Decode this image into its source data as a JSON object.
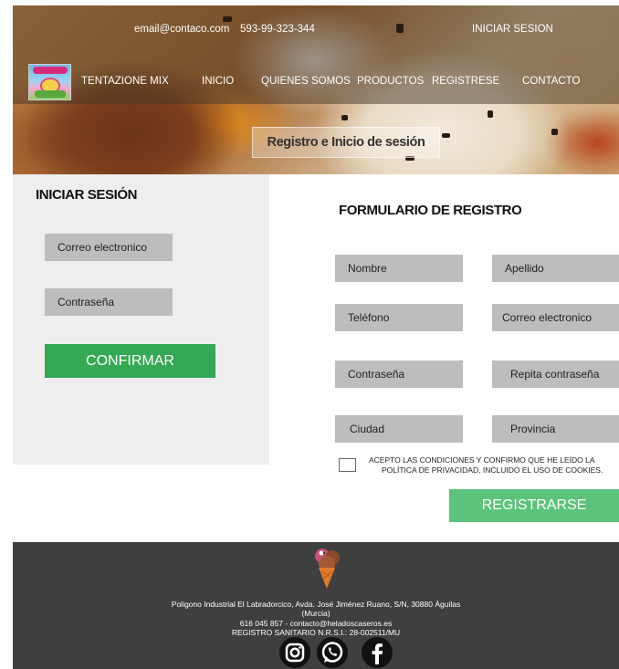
{
  "topbar": {
    "email": "email@contaco.com",
    "phone": "593-99-323-344",
    "login_link": "INICIAR SESION"
  },
  "brand": {
    "name": "TENTAZIONE MIX"
  },
  "nav": {
    "items": [
      "INICIO",
      "QUIENES SOMOS",
      "PRODUCTOS",
      "REGISTRESE",
      "CONTACTO"
    ]
  },
  "hero": {
    "title": "Registro e Inicio de sesión"
  },
  "login": {
    "title": "INICIAR SESIÓN",
    "email_field": "Correo electronico",
    "password_field": "Contraseña",
    "confirm_button": "CONFIRMAR"
  },
  "register": {
    "title": "FORMULARIO DE REGISTRO",
    "fields": {
      "nombre": "Nombre",
      "apellido": "Apellido",
      "telefono": "Teléfono",
      "correo": "Correo electronico",
      "contrasena": "Contraseña",
      "repita": "Repita contraseña",
      "ciudad": "Ciudad",
      "provincia": "Provincia"
    },
    "terms_line1": "ACEPTO LAS CONDICIONES Y CONFIRMO QUE HE LEÍDO LA",
    "terms_line2": "POLÍTICA DE PRIVACIDAD, INCLUIDO EL USO DE COOKIES.",
    "submit_button": "REGISTRARSE"
  },
  "footer": {
    "address_line1": "Poligono Industrial El Labradorcico, Avda. José Jiménez Ruano, S/N, 30880 Águilas",
    "address_line2": "(Murcia)",
    "contact_line": "616 045 857 -  contacto@heladoscaseros.es",
    "registry_line": "REGISTRO SANITARIO N.R.S.I.: 28-002511/MU"
  },
  "colors": {
    "confirm_green": "#34a853",
    "register_green": "#5cc37a",
    "field_gray": "#bdbdbd",
    "panel_gray": "#eeeeee",
    "footer_bg": "#3f3f3f"
  },
  "icons": [
    "instagram-icon",
    "whatsapp-icon",
    "facebook-icon",
    "ice-cream-cone-icon"
  ]
}
